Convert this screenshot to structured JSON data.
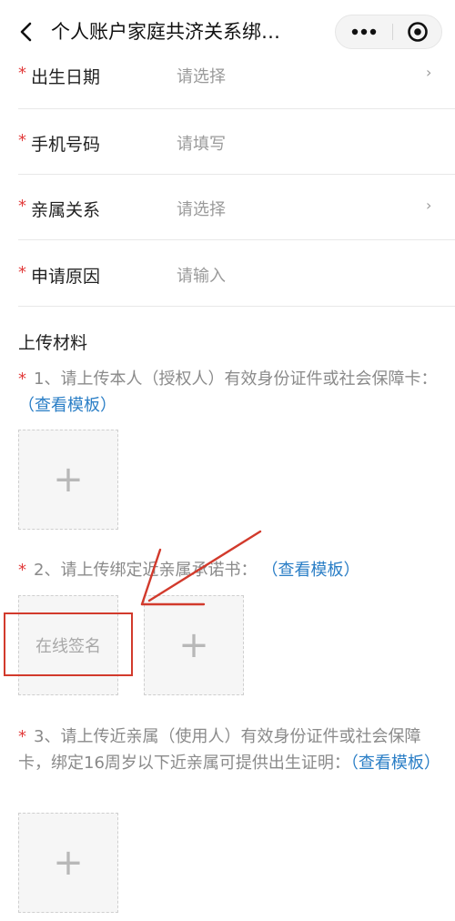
{
  "header": {
    "back_icon": "chevron-left-icon",
    "title": "个人账户家庭共济关系绑…",
    "more_icon": "more-dots-icon",
    "target_icon": "target-icon"
  },
  "form": {
    "rows": [
      {
        "required": "*",
        "label": "出生日期",
        "value": "请选择",
        "chevron": "›"
      },
      {
        "required": "*",
        "label": "手机号码",
        "value": "请填写"
      },
      {
        "required": "*",
        "label": "亲属关系",
        "value": "请选择",
        "chevron": "›"
      },
      {
        "required": "*",
        "label": "申请原因",
        "value": "请输入"
      }
    ]
  },
  "upload_section": {
    "title": "上传材料",
    "items": [
      {
        "required": "*",
        "text": "1、请上传本人（授权人）有效身份证件或社会保障卡：",
        "link": "（查看模板）"
      },
      {
        "required": "*",
        "text": "2、请上传绑定近亲属承诺书：",
        "link": "（查看模板）",
        "sign_label": "在线签名"
      },
      {
        "required": "*",
        "text": "3、请上传近亲属（使用人）有效身份证件或社会保障卡，绑定16周岁以下近亲属可提供出生证明：",
        "link": "（查看模板）"
      }
    ],
    "plus": "+"
  },
  "colors": {
    "required": "#e23b3b",
    "link": "#2a7ec6",
    "annotation": "#d23a2c"
  }
}
